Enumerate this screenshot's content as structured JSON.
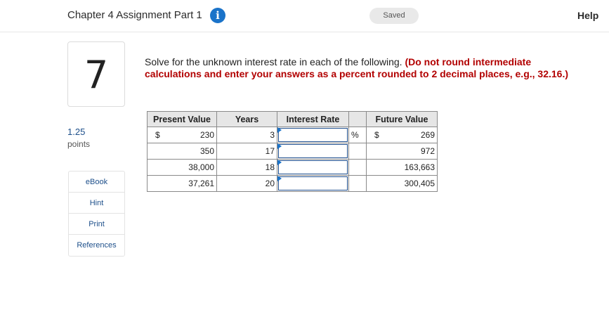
{
  "header": {
    "title": "Chapter 4 Assignment Part 1",
    "info_glyph": "i",
    "saved_label": "Saved",
    "help_label": "Help"
  },
  "question": {
    "number": "7",
    "points_value": "1.25",
    "points_label": "points",
    "prompt": "Solve for the unknown interest rate in each of the following.",
    "note": "(Do not round intermediate calculations and enter your answers as a percent rounded to 2 decimal places, e.g., 32.16.)"
  },
  "side_menu": [
    "eBook",
    "Hint",
    "Print",
    "References"
  ],
  "table": {
    "headers": {
      "present_value": "Present Value",
      "years": "Years",
      "interest_rate": "Interest Rate",
      "future_value": "Future Value"
    },
    "currency_symbol": "$",
    "percent_symbol": "%",
    "rows": [
      {
        "pv": "230",
        "years": "3",
        "rate": "",
        "fv": "269"
      },
      {
        "pv": "350",
        "years": "17",
        "rate": "",
        "fv": "972"
      },
      {
        "pv": "38,000",
        "years": "18",
        "rate": "",
        "fv": "163,663"
      },
      {
        "pv": "37,261",
        "years": "20",
        "rate": "",
        "fv": "300,405"
      }
    ]
  },
  "colors": {
    "accent": "#1a73c9",
    "note_red": "#b20000",
    "link_blue": "#1d4f8a"
  }
}
